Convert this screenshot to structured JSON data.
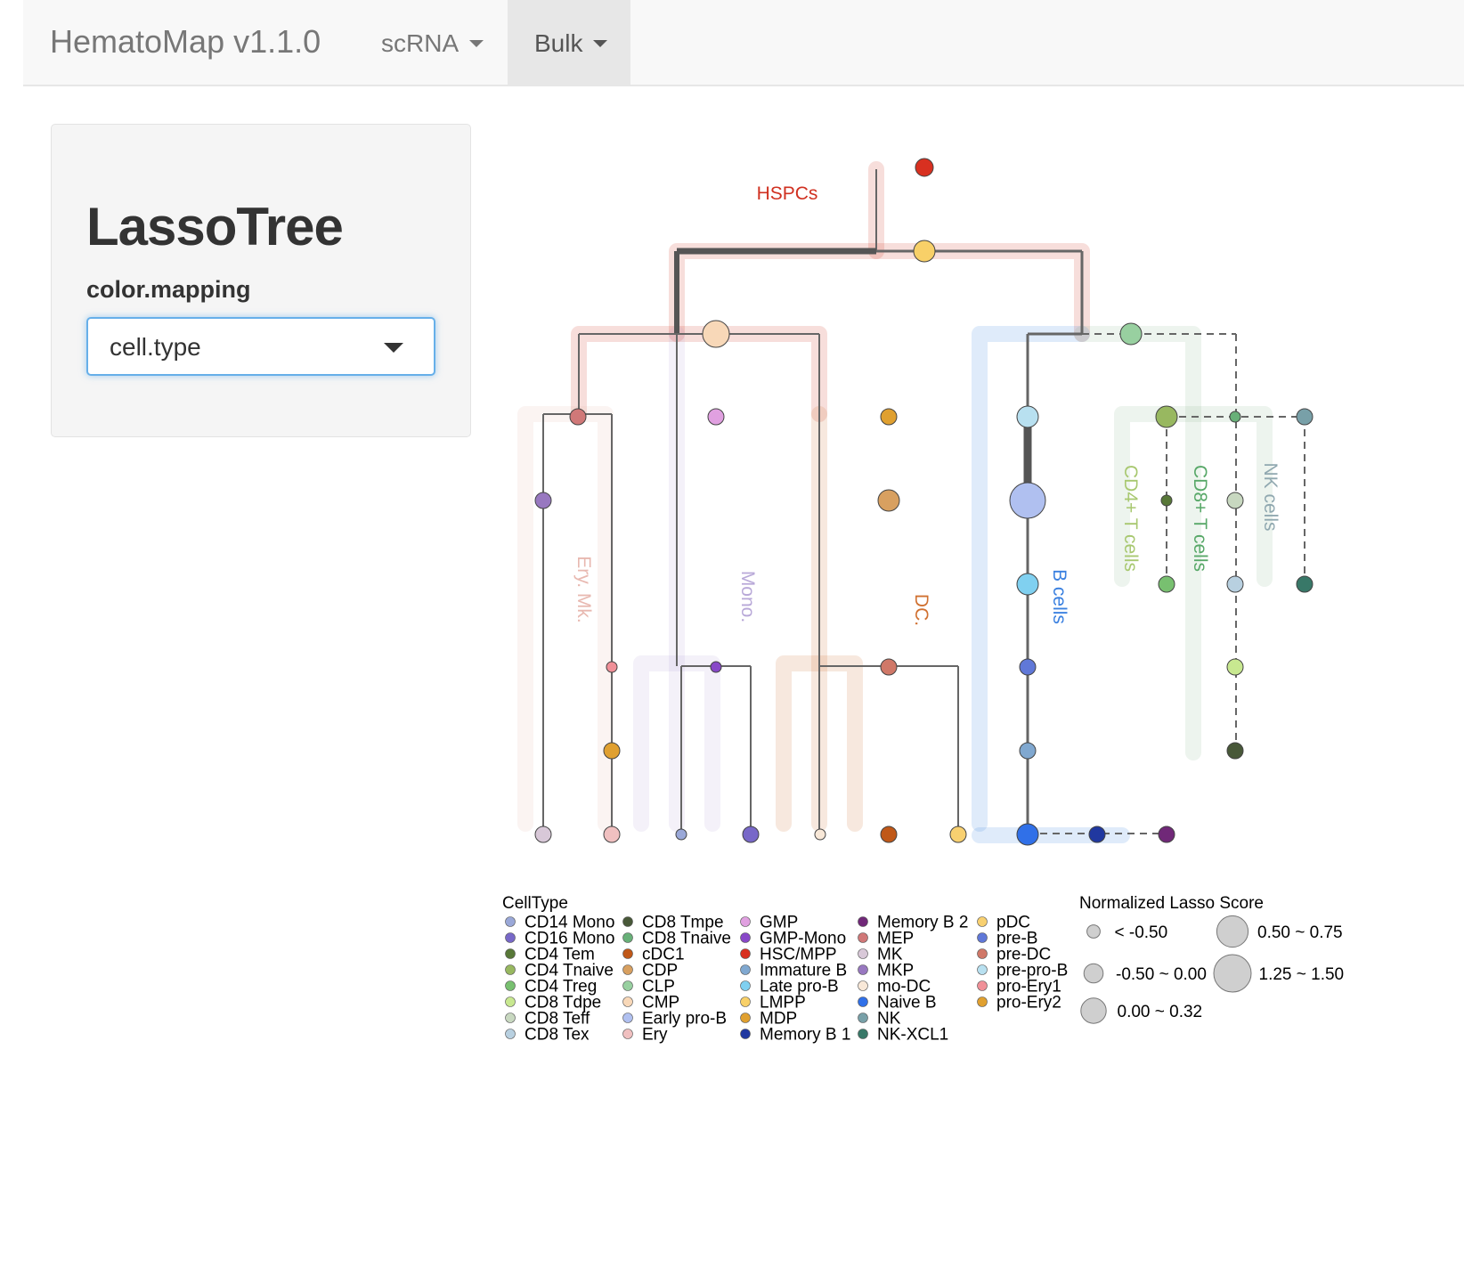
{
  "navbar": {
    "brand": "HematoMap v1.1.0",
    "menus": [
      {
        "label": "scRNA",
        "active": false
      },
      {
        "label": "Bulk",
        "active": true
      }
    ]
  },
  "sidebar": {
    "title": "LassoTree",
    "field_label": "color.mapping",
    "selected": "cell.type"
  },
  "tree": {
    "groups": [
      {
        "label": "HSPCs",
        "color": "#d03020"
      },
      {
        "label": "Ery. Mk.",
        "color": "#e8b8b0"
      },
      {
        "label": "Mono.",
        "color": "#b8a8d8"
      },
      {
        "label": "DC.",
        "color": "#d07030"
      },
      {
        "label": "B cells",
        "color": "#3a80e0"
      },
      {
        "label": "CD4+ T cells",
        "color": "#a8c870"
      },
      {
        "label": "CD8+ T cells",
        "color": "#58a868"
      },
      {
        "label": "NK cells",
        "color": "#90a8b0"
      }
    ]
  },
  "legend": {
    "celltype_title": "CellType",
    "cell_types": [
      {
        "name": "CD14 Mono",
        "color": "#9aa8d8"
      },
      {
        "name": "CD16 Mono",
        "color": "#7868c8"
      },
      {
        "name": "CD4 Tem",
        "color": "#587838"
      },
      {
        "name": "CD4 Tnaive",
        "color": "#98b860"
      },
      {
        "name": "CD4 Treg",
        "color": "#78c070"
      },
      {
        "name": "CD8 Tdpe",
        "color": "#c8e890"
      },
      {
        "name": "CD8 Teff",
        "color": "#c8d8c0"
      },
      {
        "name": "CD8 Tex",
        "color": "#b8d0e0"
      },
      {
        "name": "CD8 Tmpe",
        "color": "#485838"
      },
      {
        "name": "CD8 Tnaive",
        "color": "#68b078"
      },
      {
        "name": "cDC1",
        "color": "#c05818"
      },
      {
        "name": "CDP",
        "color": "#d8a060"
      },
      {
        "name": "CLP",
        "color": "#98d0a0"
      },
      {
        "name": "CMP",
        "color": "#f8d8b8"
      },
      {
        "name": "Early pro-B",
        "color": "#b0c0f0"
      },
      {
        "name": "Ery",
        "color": "#f0c0c0"
      },
      {
        "name": "GMP",
        "color": "#e0a0e0"
      },
      {
        "name": "GMP-Mono",
        "color": "#8848c8"
      },
      {
        "name": "HSC/MPP",
        "color": "#d83020"
      },
      {
        "name": "Immature B",
        "color": "#80a8d0"
      },
      {
        "name": "Late pro-B",
        "color": "#80d0f0"
      },
      {
        "name": "LMPP",
        "color": "#f8d068"
      },
      {
        "name": "MDP",
        "color": "#e0a030"
      },
      {
        "name": "Memory B 1",
        "color": "#2038a0"
      },
      {
        "name": "Memory B 2",
        "color": "#702878"
      },
      {
        "name": "MEP",
        "color": "#d07878"
      },
      {
        "name": "MK",
        "color": "#d8c8d8"
      },
      {
        "name": "MKP",
        "color": "#9878c0"
      },
      {
        "name": "mo-DC",
        "color": "#f8e8d8"
      },
      {
        "name": "Naive B",
        "color": "#3070e8"
      },
      {
        "name": "NK",
        "color": "#78a0a8"
      },
      {
        "name": "NK-XCL1",
        "color": "#387868"
      },
      {
        "name": "pDC",
        "color": "#f8d070"
      },
      {
        "name": "pre-B",
        "color": "#6078d8"
      },
      {
        "name": "pre-DC",
        "color": "#d07868"
      },
      {
        "name": "pre-pro-B",
        "color": "#b8e0f0"
      },
      {
        "name": "pro-Ery1",
        "color": "#f09098"
      },
      {
        "name": "pro-Ery2",
        "color": "#e0a030"
      }
    ],
    "score_title": "Normalized Lasso Score",
    "score_levels": [
      {
        "label": "< -0.50",
        "size": 1
      },
      {
        "label": "-0.50 ~ 0.00",
        "size": 2
      },
      {
        "label": "0.00 ~ 0.32",
        "size": 3
      },
      {
        "label": "0.50 ~ 0.75",
        "size": 4
      },
      {
        "label": "1.25 ~ 1.50",
        "size": 5
      }
    ]
  }
}
